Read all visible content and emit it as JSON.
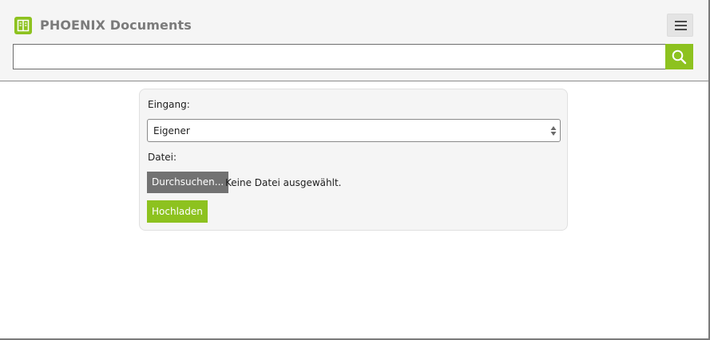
{
  "header": {
    "app_title": "PHOENIX Documents",
    "logo_icon": "document-grid-icon",
    "menu_icon": "hamburger-menu-icon",
    "brand_color": "#8dc21f"
  },
  "search": {
    "value": "",
    "placeholder": "",
    "button_icon": "search-icon"
  },
  "form": {
    "inbox_label": "Eingang:",
    "inbox_selected": "Eigener",
    "file_label": "Datei:",
    "browse_label": "Durchsuchen...",
    "file_status": "Keine Datei ausgewählt.",
    "upload_label": "Hochladen"
  }
}
